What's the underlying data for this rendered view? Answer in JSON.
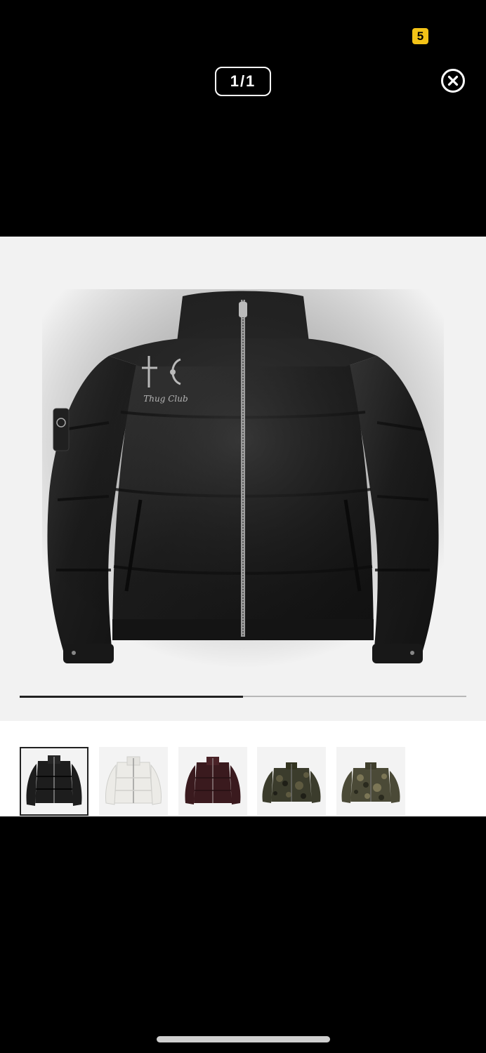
{
  "status": {
    "badge_count": "5"
  },
  "viewer": {
    "counter": "1/1",
    "progress_fraction": 0.5
  },
  "product_image": {
    "embroidery_text": "Thug Club"
  },
  "thumbnails": [
    {
      "name": "black-jacket",
      "color": "#1d1d1d",
      "selected": true
    },
    {
      "name": "white-jacket",
      "color": "#ececea",
      "selected": false
    },
    {
      "name": "burgundy-jacket",
      "color": "#3a1a1e",
      "selected": false
    },
    {
      "name": "camo-jacket-dark",
      "color": "#3b3c2c",
      "selected": false
    },
    {
      "name": "camo-jacket-light",
      "color": "#4b4a37",
      "selected": false
    }
  ],
  "colors": {
    "accent_badge": "#f3c317",
    "background": "#000000",
    "stage": "#f2f2f2"
  }
}
